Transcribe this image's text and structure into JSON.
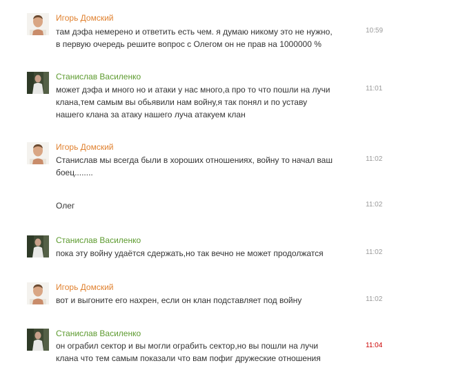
{
  "messages": [
    {
      "author": "Игорь Домский",
      "author_color": "#e0802e",
      "lines": [
        "там дэфа немерено и ответить есть чем. я думаю никому это не нужно,",
        "в первую очередь решите вопрос с Олегом  он не прав на 1000000 %"
      ],
      "time": "10:59"
    },
    {
      "author": "Станислав Василенко",
      "author_color": "#5c9a2e",
      "lines": [
        "может дэфа и много но и атаки у нас много,а про то что пошли на лучи",
        "клана,тем самым вы обьявили нам войну,я так понял и по уставу",
        "нашего клана за атаку нашего луча атакуем клан"
      ],
      "time": "11:01"
    },
    {
      "author": "Игорь Домский",
      "author_color": "#e0802e",
      "lines": [
        "Станислав мы всегда были в хороших отношениях, войну то начал ваш",
        "боец........"
      ],
      "time": "11:02"
    },
    {
      "author": "",
      "lines": [
        "Олег"
      ],
      "time": "11:02"
    },
    {
      "author": "Станислав Василенко",
      "author_color": "#5c9a2e",
      "lines": [
        "пока эту войну удаётся сдержать,но так вечно не может продолжатся"
      ],
      "time": "11:02"
    },
    {
      "author": "Игорь Домский",
      "author_color": "#e0802e",
      "lines": [
        "вот и выгоните его нахрен, если он клан подставляет под войну"
      ],
      "time": "11:02"
    },
    {
      "author": "Станислав Василенко",
      "author_color": "#5c9a2e",
      "lines": [
        "он ограбил сектор и вы могли ограбить сектор,но вы пошли на лучи",
        "клана что тем самым показали что вам пофиг дружеские отношения"
      ],
      "time": "11:04",
      "time_color": "#cc0000"
    }
  ]
}
